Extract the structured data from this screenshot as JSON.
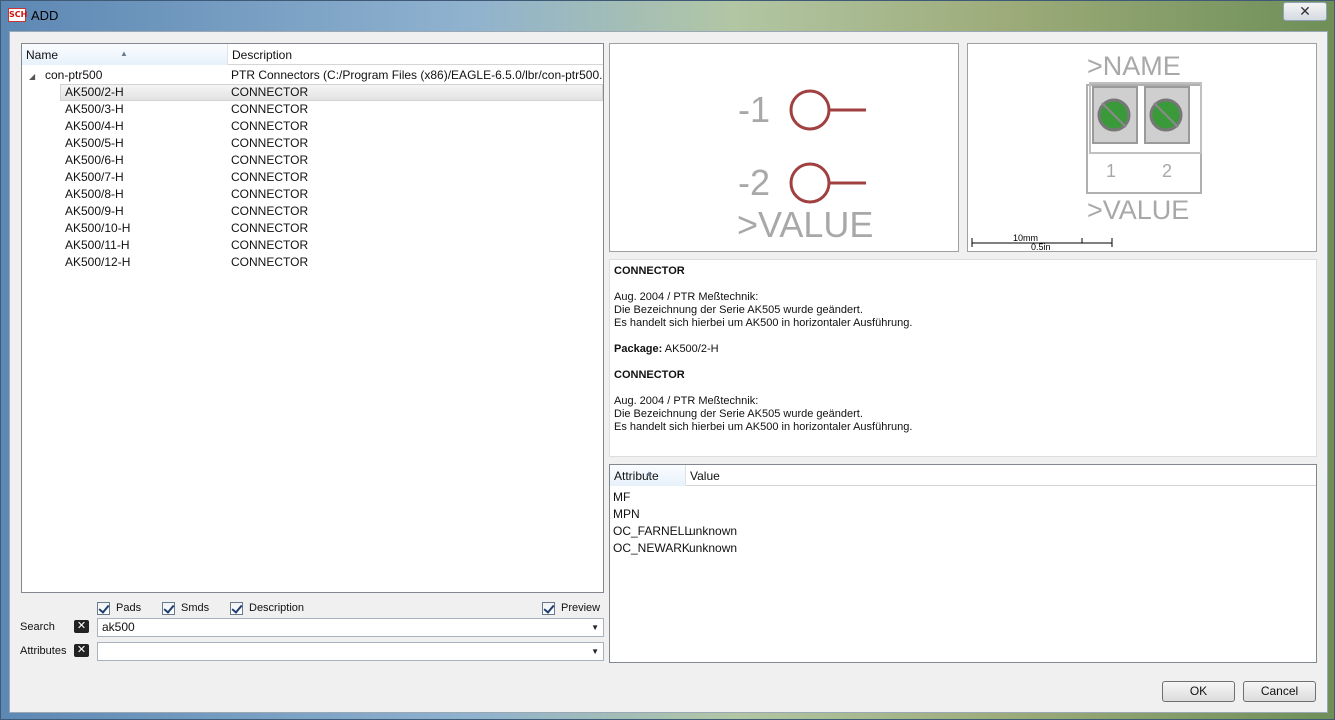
{
  "window": {
    "title": "ADD",
    "app_icon_text": "SCH",
    "close_glyph": "✕"
  },
  "tree": {
    "columns": {
      "name": "Name",
      "description": "Description"
    },
    "root": {
      "name": "con-ptr500",
      "description": "PTR Connectors (C:/Program Files (x86)/EAGLE-6.5.0/lbr/con-ptr500...."
    },
    "items": [
      {
        "name": "AK500/2-H",
        "description": "CONNECTOR",
        "selected": true
      },
      {
        "name": "AK500/3-H",
        "description": "CONNECTOR"
      },
      {
        "name": "AK500/4-H",
        "description": "CONNECTOR"
      },
      {
        "name": "AK500/5-H",
        "description": "CONNECTOR"
      },
      {
        "name": "AK500/6-H",
        "description": "CONNECTOR"
      },
      {
        "name": "AK500/7-H",
        "description": "CONNECTOR"
      },
      {
        "name": "AK500/8-H",
        "description": "CONNECTOR"
      },
      {
        "name": "AK500/9-H",
        "description": "CONNECTOR"
      },
      {
        "name": "AK500/10-H",
        "description": "CONNECTOR"
      },
      {
        "name": "AK500/11-H",
        "description": "CONNECTOR"
      },
      {
        "name": "AK500/12-H",
        "description": "CONNECTOR"
      }
    ]
  },
  "filters": {
    "pads_label": "Pads",
    "pads_checked": true,
    "smds_label": "Smds",
    "smds_checked": true,
    "description_label": "Description",
    "description_checked": true,
    "preview_label": "Preview",
    "preview_checked": true
  },
  "search": {
    "label": "Search",
    "value": "ak500"
  },
  "attributes_filter": {
    "label": "Attributes",
    "value": ""
  },
  "symbol_preview": {
    "pin1": "-1",
    "pin2": "-2",
    "value_label": ">VALUE",
    "pin_color": "#a04040",
    "text_color": "#a8a8a8"
  },
  "package_preview": {
    "name_label": ">NAME",
    "value_label": ">VALUE",
    "pad1": "1",
    "pad2": "2",
    "scale_mm": "10mm",
    "scale_in": "0.5in",
    "pad_color": "#3a9a3a"
  },
  "description": {
    "title1": "CONNECTOR",
    "line1": "Aug. 2004 / PTR Meßtechnik:",
    "line2": "Die Bezeichnung der Serie AK505 wurde geändert.",
    "line3": "Es handelt sich hierbei um AK500 in horizontaler Ausführung.",
    "package_label": "Package:",
    "package_value": "AK500/2-H",
    "title2": "CONNECTOR",
    "line4": "Aug. 2004 / PTR Meßtechnik:",
    "line5": "Die Bezeichnung der Serie AK505 wurde geändert.",
    "line6": "Es handelt sich hierbei um AK500 in horizontaler Ausführung."
  },
  "attributes": {
    "columns": {
      "attribute": "Attribute",
      "value": "Value"
    },
    "rows": [
      {
        "name": "MF",
        "value": ""
      },
      {
        "name": "MPN",
        "value": ""
      },
      {
        "name": "OC_FARNELL",
        "value": "unknown"
      },
      {
        "name": "OC_NEWARK",
        "value": "unknown"
      }
    ]
  },
  "buttons": {
    "ok": "OK",
    "cancel": "Cancel"
  }
}
